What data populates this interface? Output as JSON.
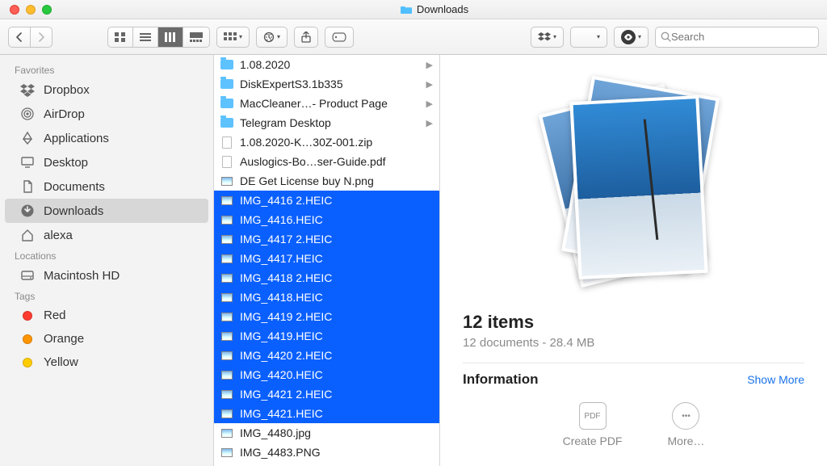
{
  "window": {
    "title": "Downloads"
  },
  "search": {
    "placeholder": "Search"
  },
  "sidebar": {
    "sections": [
      {
        "label": "Favorites",
        "items": [
          {
            "icon": "dropbox",
            "label": "Dropbox"
          },
          {
            "icon": "airdrop",
            "label": "AirDrop"
          },
          {
            "icon": "apps",
            "label": "Applications"
          },
          {
            "icon": "desktop",
            "label": "Desktop"
          },
          {
            "icon": "docs",
            "label": "Documents"
          },
          {
            "icon": "downloads",
            "label": "Downloads",
            "selected": true
          },
          {
            "icon": "home",
            "label": "alexa"
          }
        ]
      },
      {
        "label": "Locations",
        "items": [
          {
            "icon": "disk",
            "label": "Macintosh HD"
          }
        ]
      },
      {
        "label": "Tags",
        "items": [
          {
            "icon": "tag",
            "color": "#ff3b30",
            "label": "Red"
          },
          {
            "icon": "tag",
            "color": "#ff9500",
            "label": "Orange"
          },
          {
            "icon": "tag",
            "color": "#ffcc00",
            "label": "Yellow"
          }
        ]
      }
    ]
  },
  "files": [
    {
      "type": "folder",
      "label": "1.08.2020",
      "hasChildren": true
    },
    {
      "type": "folder",
      "label": "DiskExpertS3.1b335",
      "hasChildren": true
    },
    {
      "type": "folder",
      "label": "MacCleaner…- Product Page",
      "hasChildren": true
    },
    {
      "type": "folder",
      "label": "Telegram Desktop",
      "hasChildren": true
    },
    {
      "type": "file",
      "label": "1.08.2020-K…30Z-001.zip"
    },
    {
      "type": "file",
      "label": "Auslogics-Bo…ser-Guide.pdf"
    },
    {
      "type": "image",
      "label": "DE Get License buy N.png"
    },
    {
      "type": "image",
      "label": "IMG_4416 2.HEIC",
      "selected": true
    },
    {
      "type": "image",
      "label": "IMG_4416.HEIC",
      "selected": true
    },
    {
      "type": "image",
      "label": "IMG_4417 2.HEIC",
      "selected": true
    },
    {
      "type": "image",
      "label": "IMG_4417.HEIC",
      "selected": true
    },
    {
      "type": "image",
      "label": "IMG_4418 2.HEIC",
      "selected": true
    },
    {
      "type": "image",
      "label": "IMG_4418.HEIC",
      "selected": true
    },
    {
      "type": "image",
      "label": "IMG_4419 2.HEIC",
      "selected": true
    },
    {
      "type": "image",
      "label": "IMG_4419.HEIC",
      "selected": true
    },
    {
      "type": "image",
      "label": "IMG_4420 2.HEIC",
      "selected": true
    },
    {
      "type": "image",
      "label": "IMG_4420.HEIC",
      "selected": true
    },
    {
      "type": "image",
      "label": "IMG_4421 2.HEIC",
      "selected": true
    },
    {
      "type": "image",
      "label": "IMG_4421.HEIC",
      "selected": true
    },
    {
      "type": "image",
      "label": "IMG_4480.jpg"
    },
    {
      "type": "image",
      "label": "IMG_4483.PNG"
    }
  ],
  "info": {
    "title": "12 items",
    "subtitle": "12 documents - 28.4 MB",
    "section": "Information",
    "showMore": "Show More",
    "actions": {
      "createPdf": "Create PDF",
      "more": "More…"
    }
  }
}
